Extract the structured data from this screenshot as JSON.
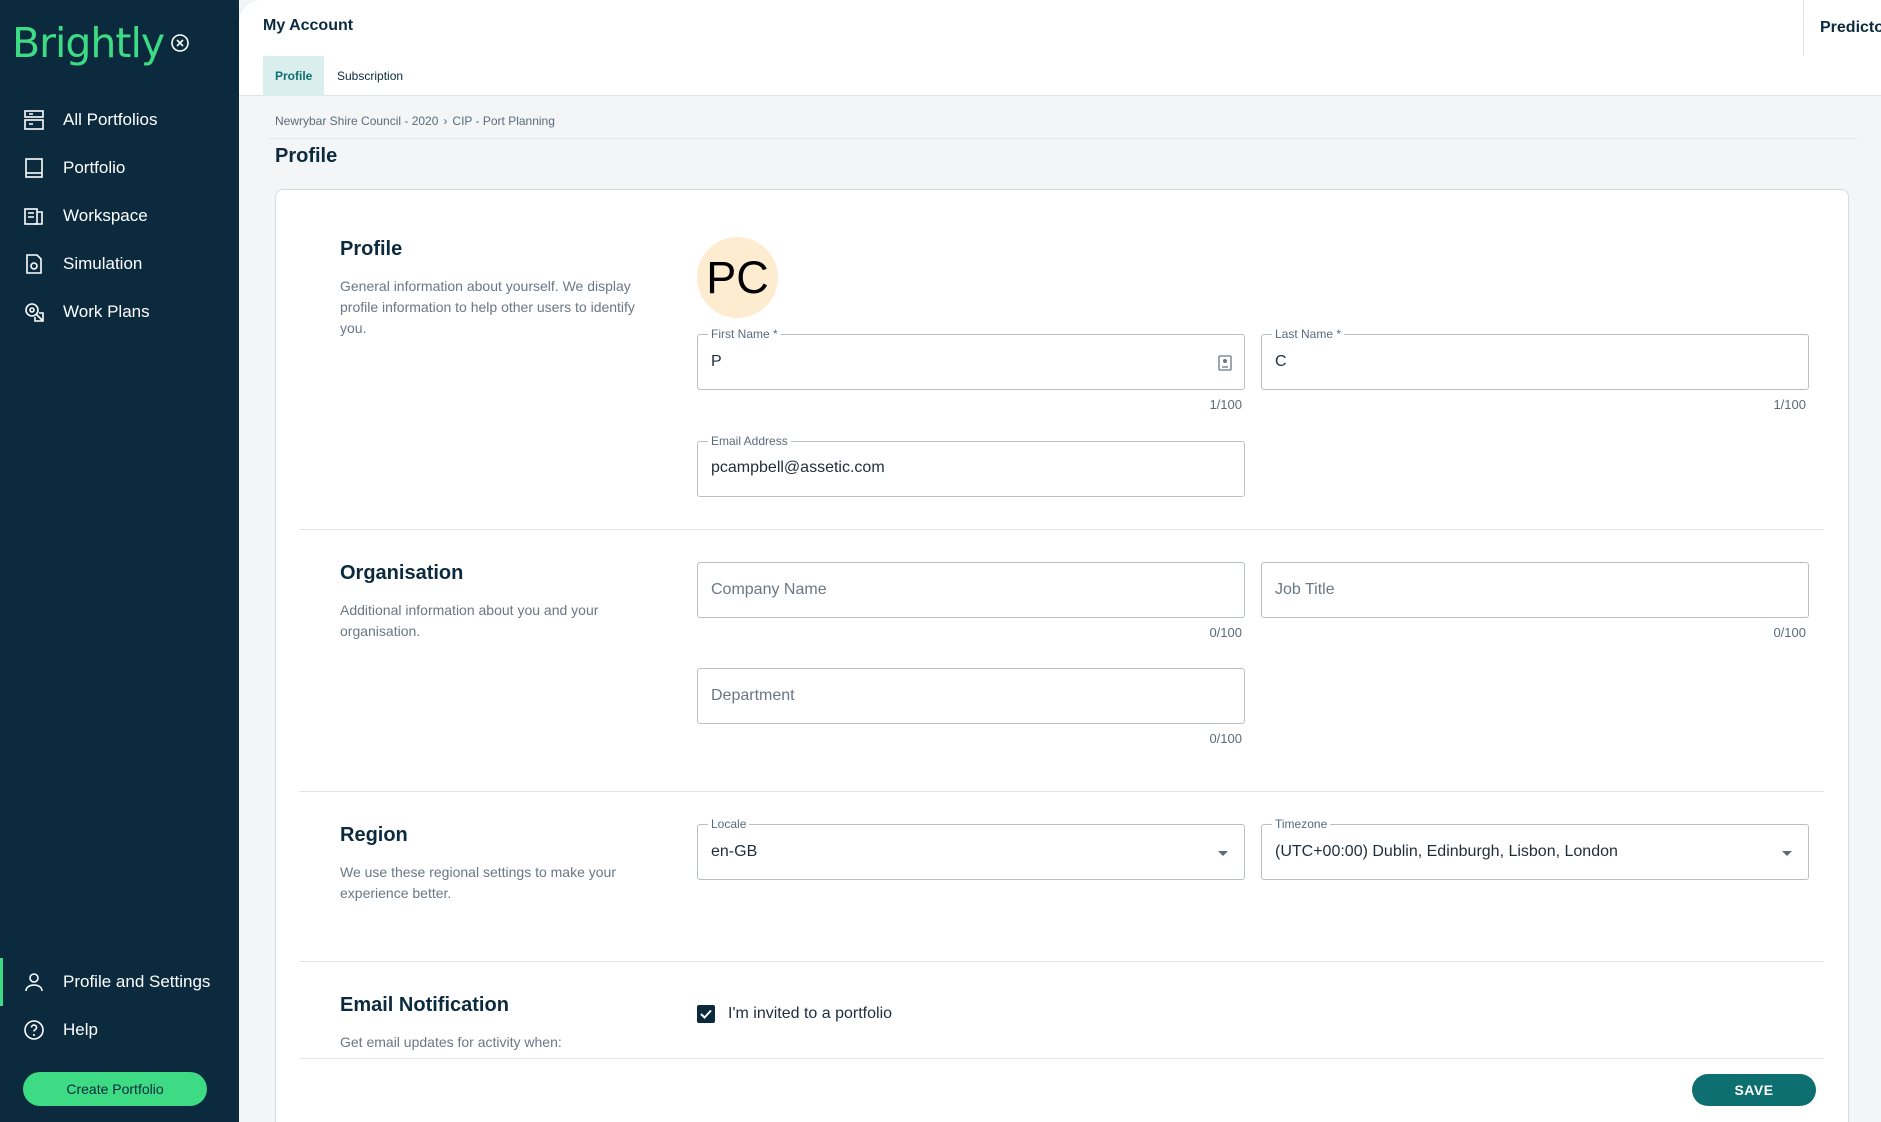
{
  "app": {
    "logo_text": "Brightly",
    "brand_color": "#3ddc84",
    "sidebar_color": "#0b2a3e",
    "accent_color": "#0d6f6f"
  },
  "sidebar": {
    "items": [
      {
        "label": "All Portfolios",
        "icon": "portfolios-icon"
      },
      {
        "label": "Portfolio",
        "icon": "portfolio-icon"
      },
      {
        "label": "Workspace",
        "icon": "workspace-icon"
      },
      {
        "label": "Simulation",
        "icon": "simulation-icon"
      },
      {
        "label": "Work Plans",
        "icon": "work-plans-icon"
      }
    ],
    "bottom_items": [
      {
        "label": "Profile and Settings",
        "icon": "user-icon",
        "active": true
      },
      {
        "label": "Help",
        "icon": "help-icon"
      }
    ],
    "create_button": "Create Portfolio"
  },
  "header": {
    "title": "My Account",
    "right_label": "Predictor"
  },
  "tabs": [
    {
      "label": "Profile",
      "active": true
    },
    {
      "label": "Subscription",
      "active": false
    }
  ],
  "breadcrumb": {
    "items": [
      "Newrybar Shire Council - 2020",
      "CIP - Port Planning"
    ],
    "separator": "›"
  },
  "page_title": "Profile",
  "sections": {
    "profile": {
      "title": "Profile",
      "description": "General information about yourself. We display profile information to help other users to identify you.",
      "avatar_initials": "PC",
      "first_name": {
        "label": "First Name *",
        "value": "P",
        "counter": "1/100"
      },
      "last_name": {
        "label": "Last Name *",
        "value": "C",
        "counter": "1/100"
      },
      "email": {
        "label": "Email Address",
        "value": "pcampbell@assetic.com"
      }
    },
    "organisation": {
      "title": "Organisation",
      "description": "Additional information about you and your organisation.",
      "company": {
        "placeholder": "Company Name",
        "counter": "0/100"
      },
      "job_title": {
        "placeholder": "Job Title",
        "counter": "0/100"
      },
      "department": {
        "placeholder": "Department",
        "counter": "0/100"
      }
    },
    "region": {
      "title": "Region",
      "description": "We use these regional settings to make your experience better.",
      "locale": {
        "label": "Locale",
        "value": "en-GB"
      },
      "timezone": {
        "label": "Timezone",
        "value": "(UTC+00:00) Dublin, Edinburgh, Lisbon, London"
      }
    },
    "email_notification": {
      "title": "Email Notification",
      "description": "Get email updates for activity when:",
      "options": [
        {
          "label": "I'm invited to a portfolio",
          "checked": true
        }
      ]
    }
  },
  "save_button": "SAVE"
}
